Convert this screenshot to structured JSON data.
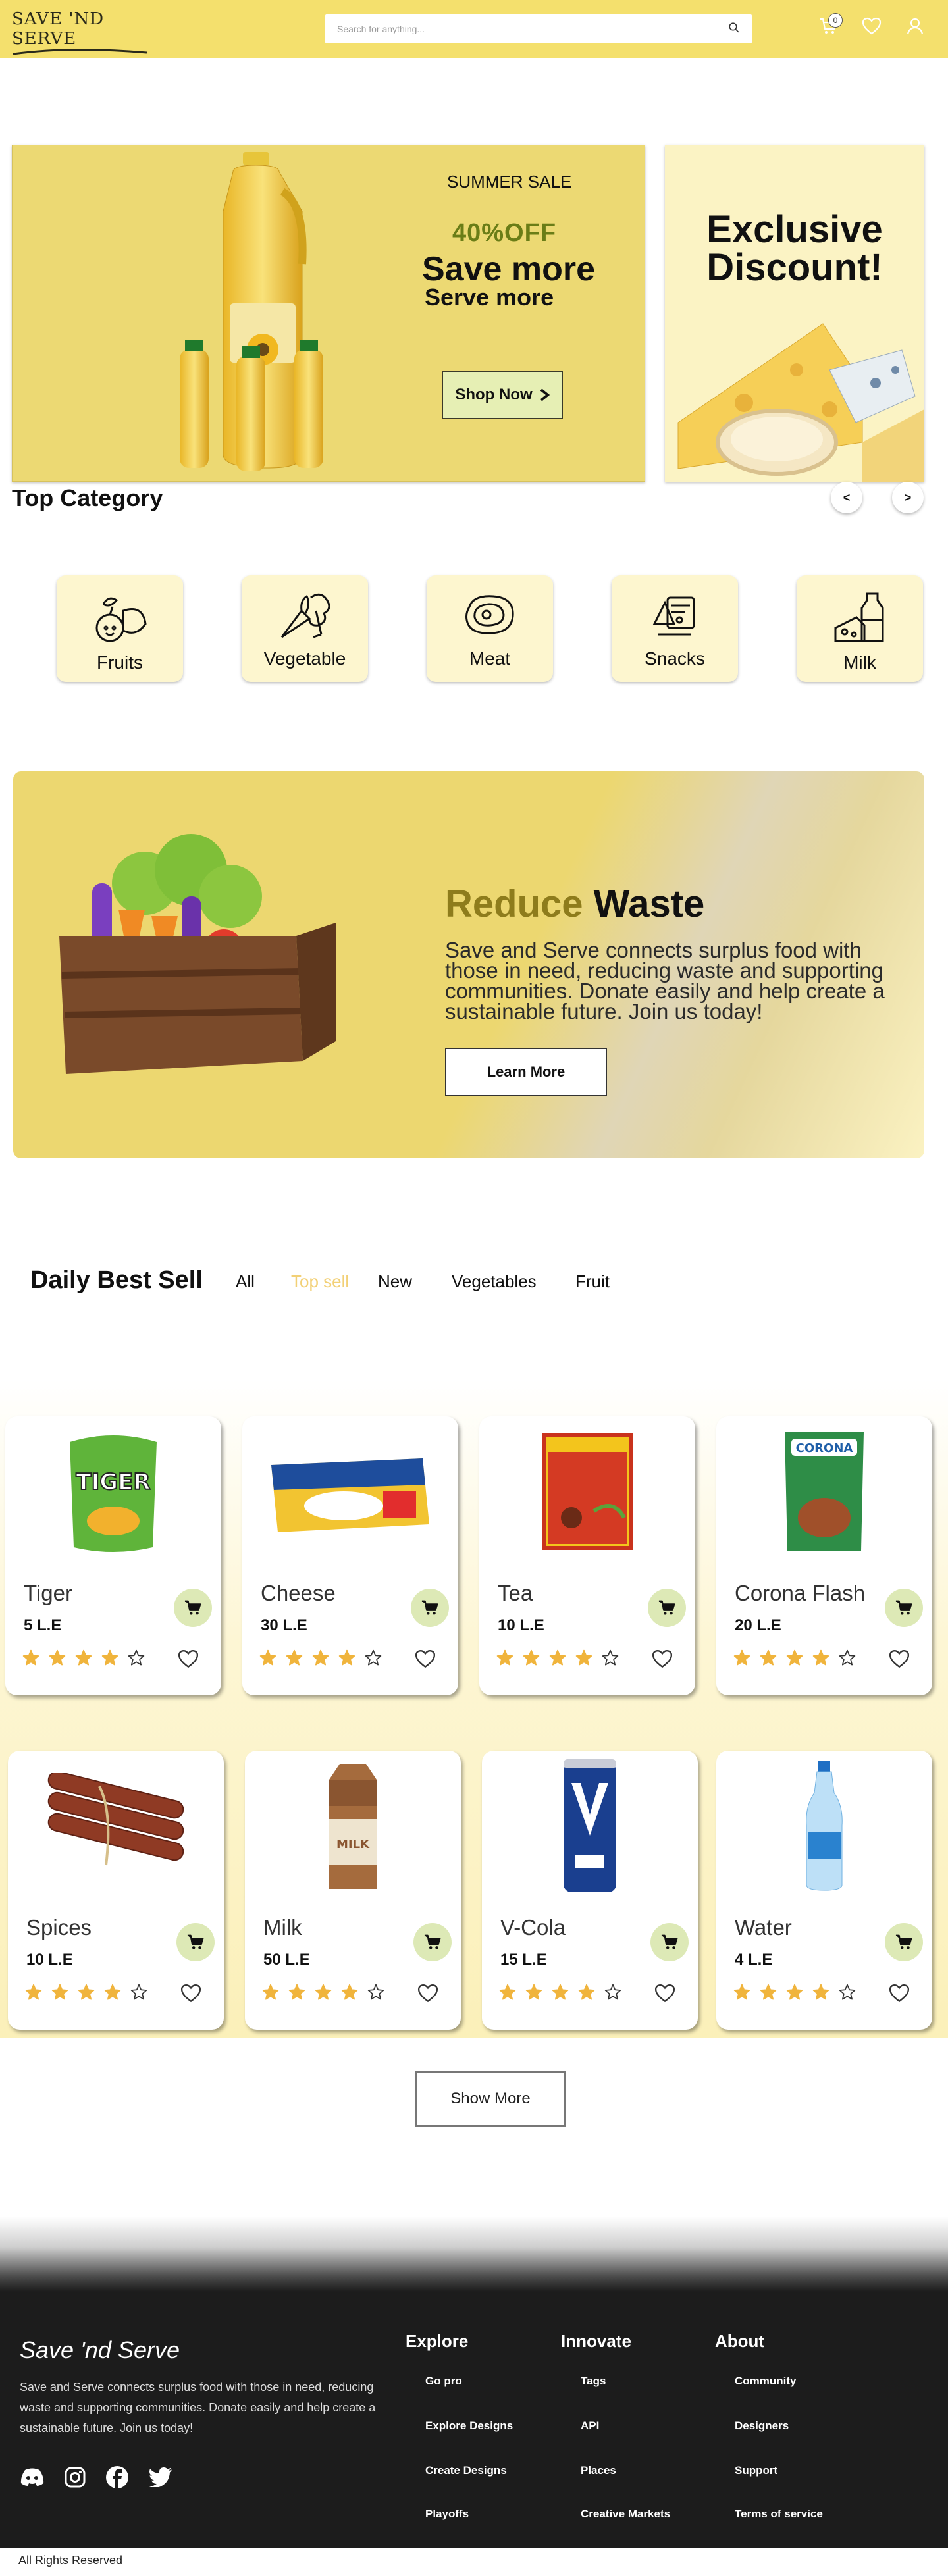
{
  "header": {
    "logo": "SAVE 'ND SERVE",
    "search_placeholder": "Search for anything...",
    "cart_count": "0"
  },
  "hero": {
    "summer": "SUMMER SALE",
    "percent": "40%OFF",
    "save_more": "Save more",
    "serve_more": "Serve more",
    "shop_now": "Shop Now",
    "exclusive": "Exclusive Discount!"
  },
  "categories": {
    "title": "Top Category",
    "prev": "<",
    "next": ">",
    "items": [
      {
        "label": "Fruits"
      },
      {
        "label": "Vegetable"
      },
      {
        "label": "Meat"
      },
      {
        "label": "Snacks"
      },
      {
        "label": "Milk"
      }
    ]
  },
  "waste": {
    "reduce": "Reduce",
    "waste_word": "Waste",
    "text": "Save and Serve connects surplus food with those in need, reducing waste and supporting communities. Donate easily and help create a sustainable future. Join us today!",
    "button": "Learn More"
  },
  "daily": {
    "title": "Daily Best Sell",
    "filters": [
      "All",
      "Top sell",
      "New",
      "Vegetables",
      "Fruit"
    ],
    "active_filter_color": "#f2d076"
  },
  "products": [
    {
      "name": "Tiger",
      "price": "5 L.E",
      "rating": 4
    },
    {
      "name": "Cheese",
      "price": "30 L.E",
      "rating": 4
    },
    {
      "name": "Tea",
      "price": "10 L.E",
      "rating": 4
    },
    {
      "name": "Corona Flash",
      "price": "20 L.E",
      "rating": 4
    },
    {
      "name": "Spices",
      "price": "10 L.E",
      "rating": 4
    },
    {
      "name": "Milk",
      "price": "50 L.E",
      "rating": 4
    },
    {
      "name": "V-Cola",
      "price": "15 L.E",
      "rating": 4
    },
    {
      "name": "Water",
      "price": "4 L.E",
      "rating": 4
    }
  ],
  "show_more": "Show More",
  "footer": {
    "brand": "Save 'nd Serve",
    "description": "Save and Serve connects surplus food with those in need, reducing waste and supporting communities. Donate easily and help create a sustainable future. Join us today!",
    "columns": [
      {
        "title": "Explore",
        "links": [
          "Go pro",
          "Explore Designs",
          "Create Designs",
          "Playoffs"
        ]
      },
      {
        "title": "Innovate",
        "links": [
          "Tags",
          "API",
          "Places",
          "Creative Markets"
        ]
      },
      {
        "title": "About",
        "links": [
          "Community",
          "Designers",
          "Support",
          "Terms of service"
        ]
      }
    ],
    "copyright": "All Rights Reserved"
  },
  "colors": {
    "brand_yellow": "#f4e06d",
    "cart_green": "#dde9b6",
    "footer_bg": "#1c1c1c",
    "star": "#f0b43c"
  }
}
